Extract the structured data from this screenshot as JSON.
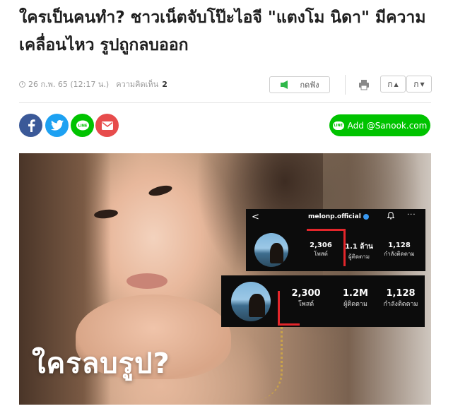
{
  "article": {
    "title": "ใครเป็นคนทำ? ชาวเน็ตจับโป๊ะไอจี \"แตงโม นิดา\" มีความเคลื่อนไหว รูปถูกลบออก",
    "date": "26 ก.พ. 65 (12:17 น.)",
    "comments_label": "ความคิดเห็น",
    "comments_count": "2"
  },
  "toolbar": {
    "listen_label": "กดฟัง",
    "font_larger_label": "ก",
    "font_smaller_label": "ก"
  },
  "share": {
    "line_badge": "LINE",
    "add_line_label": "Add @Sanook.com"
  },
  "hero": {
    "overlay_text": "ใครลบรูป?",
    "ig_before": {
      "back": "<",
      "username": "melonp.official",
      "more": "···",
      "posts": "2,306",
      "posts_label": "โพสต์",
      "followers": "1.1 ล้าน",
      "followers_label": "ผู้ติดตาม",
      "following": "1,128",
      "following_label": "กำลังติดตาม"
    },
    "ig_after": {
      "posts": "2,300",
      "posts_label": "โพสต์",
      "followers": "1.2M",
      "followers_label": "ผู้ติดตาม",
      "following": "1,128",
      "following_label": "กำลังติดตาม"
    }
  },
  "colors": {
    "facebook": "#3b5998",
    "twitter": "#1da1f2",
    "line": "#00c300",
    "mail": "#e74c4c",
    "highlight_red": "#e3262b"
  }
}
